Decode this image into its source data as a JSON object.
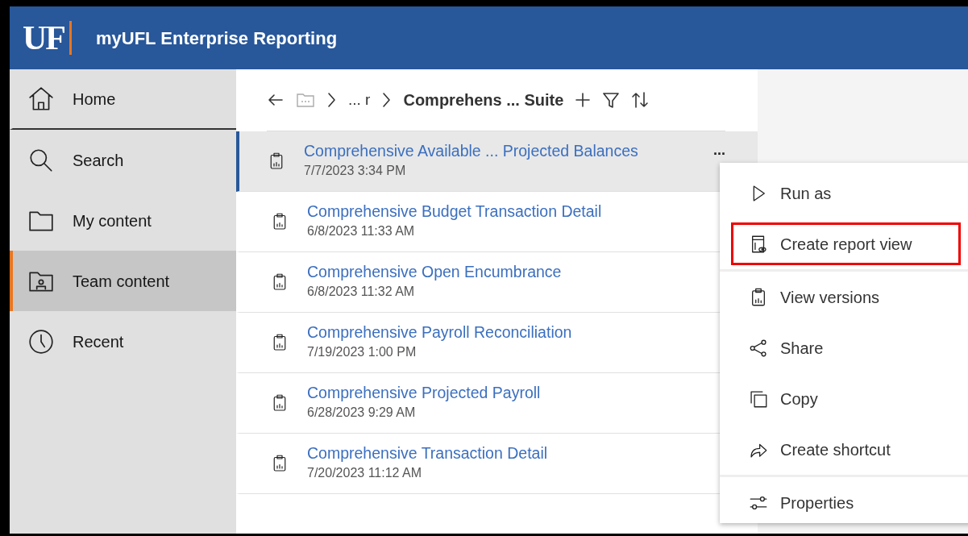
{
  "header": {
    "logo": "UF",
    "title": "myUFL Enterprise Reporting"
  },
  "sidebar": {
    "items": [
      {
        "label": "Home",
        "selected": false
      },
      {
        "label": "Search",
        "selected": false
      },
      {
        "label": "My content",
        "selected": false
      },
      {
        "label": "Team content",
        "selected": true
      },
      {
        "label": "Recent",
        "selected": false
      }
    ]
  },
  "breadcrumb": {
    "collapsed": "... r",
    "current": "Comprehens ... Suite"
  },
  "reports": [
    {
      "title": "Comprehensive Available ... Projected Balances",
      "date": "7/7/2023 3:34 PM",
      "selected": true,
      "more": "..."
    },
    {
      "title": "Comprehensive Budget Transaction Detail",
      "date": "6/8/2023 11:33 AM",
      "selected": false
    },
    {
      "title": "Comprehensive Open Encumbrance",
      "date": "6/8/2023 11:32 AM",
      "selected": false
    },
    {
      "title": "Comprehensive Payroll Reconciliation",
      "date": "7/19/2023 1:00 PM",
      "selected": false
    },
    {
      "title": "Comprehensive Projected Payroll",
      "date": "6/28/2023 9:29 AM",
      "selected": false
    },
    {
      "title": "Comprehensive Transaction Detail",
      "date": "7/20/2023 11:12 AM",
      "selected": false
    }
  ],
  "context_menu": {
    "sections": [
      [
        {
          "label": "Run as",
          "highlighted": false
        },
        {
          "label": "Create report view",
          "highlighted": true
        }
      ],
      [
        {
          "label": "View versions",
          "highlighted": false
        },
        {
          "label": "Share",
          "highlighted": false
        },
        {
          "label": "Copy",
          "highlighted": false
        },
        {
          "label": "Create shortcut",
          "highlighted": false
        }
      ],
      [
        {
          "label": "Properties",
          "highlighted": false
        }
      ]
    ]
  }
}
